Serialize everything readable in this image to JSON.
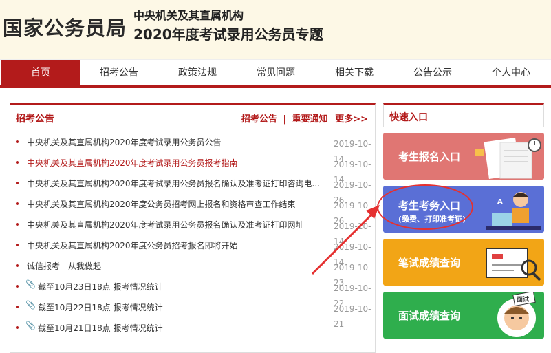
{
  "header": {
    "logo": "国家公务员局",
    "sub1": "中央机关及其直属机构",
    "sub2": "2020年度考试录用公务员专题"
  },
  "nav": [
    "首页",
    "招考公告",
    "政策法规",
    "常见问题",
    "相关下载",
    "公告公示",
    "个人中心"
  ],
  "panel": {
    "title": "招考公告",
    "link1": "招考公告",
    "sep": "|",
    "link2": "重要通知",
    "more": "更多>>"
  },
  "news": [
    {
      "text": "中央机关及其直属机构2020年度考试录用公务员公告",
      "date": "2019-10-14"
    },
    {
      "text": "中央机关及其直属机构2020年度考试录用公务员报考指南",
      "date": "2019-10-14"
    },
    {
      "text": "中央机关及其直属机构2020年度考试录用公务员报名确认及准考证打印咨询电...",
      "date": "2019-10-26"
    },
    {
      "text": "中央机关及其直属机构2020年度公务员招考网上报名和资格审查工作结束",
      "date": "2019-10-26"
    },
    {
      "text": "中央机关及其直属机构2020年度考试录用公务员报名确认及准考证打印网址",
      "date": "2019-10-14"
    },
    {
      "text": "中央机关及其直属机构2020年度公务员招考报名即将开始",
      "date": "2019-10-14"
    },
    {
      "text": "诚信报考　从我做起",
      "date": "2019-10-23"
    },
    {
      "text": "截至10月23日18点 报考情况统计",
      "date": "2019-10-22"
    },
    {
      "text": "截至10月22日18点 报考情况统计",
      "date": "2019-10-21"
    },
    {
      "text": "截至10月21日18点 报考情况统计",
      "date": ""
    }
  ],
  "side": {
    "title": "快速入口",
    "tile1": "考生报名入口",
    "tile2": "考生考务入口",
    "tile2_sub": "(缴费、打印准考证)",
    "tile3": "笔试成绩查询",
    "tile4": "面试成绩查询",
    "tile4_tag": "面试"
  },
  "colors": {
    "brand": "#b31b1b",
    "tile1": "#e07673",
    "tile2": "#5a6fd6",
    "tile3": "#f2a516",
    "tile4": "#2fae4d"
  }
}
